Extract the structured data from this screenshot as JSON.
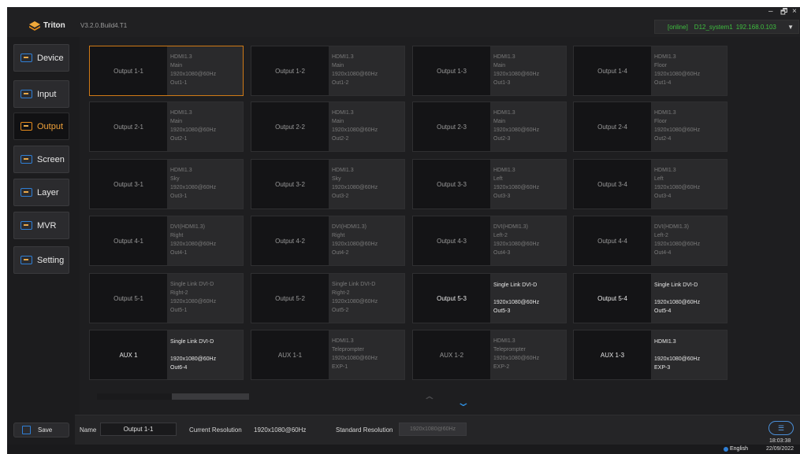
{
  "app": {
    "name": "Triton",
    "version": "V3.2.0.Build4.T1",
    "window_controls": {
      "minimize": "–",
      "maximize": "🗗",
      "close": "×"
    }
  },
  "device_status": {
    "online": "[online]",
    "device": "D12_system1",
    "ip": "192.168.0.103"
  },
  "sidebar": {
    "items": [
      {
        "label": "Device",
        "icon": "device-icon",
        "active": false
      },
      {
        "label": "Input",
        "icon": "input-icon",
        "active": false
      },
      {
        "label": "Output",
        "icon": "output-icon",
        "active": true
      },
      {
        "label": "Screen",
        "icon": "screen-icon",
        "active": false
      },
      {
        "label": "Layer",
        "icon": "layer-icon",
        "active": false
      },
      {
        "label": "MVR",
        "icon": "mvr-icon",
        "active": false
      },
      {
        "label": "Setting",
        "icon": "setting-icon",
        "active": false
      }
    ],
    "save_label": "Save"
  },
  "outputs": [
    {
      "name": "Output 1-1",
      "lines": [
        "HDMI1.3",
        "Main",
        "1920x1080@60Hz",
        "Out1-1"
      ],
      "bright": false,
      "selected": true
    },
    {
      "name": "Output 1-2",
      "lines": [
        "HDMI1.3",
        "Main",
        "1920x1080@60Hz",
        "Out1-2"
      ],
      "bright": false,
      "selected": false
    },
    {
      "name": "Output 1-3",
      "lines": [
        "HDMI1.3",
        "Main",
        "1920x1080@60Hz",
        "Out1-3"
      ],
      "bright": false,
      "selected": false
    },
    {
      "name": "Output 1-4",
      "lines": [
        "HDMI1.3",
        "Floor",
        "1920x1080@60Hz",
        "Out1-4"
      ],
      "bright": false,
      "selected": false
    },
    {
      "name": "Output 2-1",
      "lines": [
        "HDMI1.3",
        "Main",
        "1920x1080@60Hz",
        "Out2-1"
      ],
      "bright": false,
      "selected": false
    },
    {
      "name": "Output 2-2",
      "lines": [
        "HDMI1.3",
        "Main",
        "1920x1080@60Hz",
        "Out2-2"
      ],
      "bright": false,
      "selected": false
    },
    {
      "name": "Output 2-3",
      "lines": [
        "HDMI1.3",
        "Main",
        "1920x1080@60Hz",
        "Out2-3"
      ],
      "bright": false,
      "selected": false
    },
    {
      "name": "Output 2-4",
      "lines": [
        "HDMI1.3",
        "Floor",
        "1920x1080@60Hz",
        "Out2-4"
      ],
      "bright": false,
      "selected": false
    },
    {
      "name": "Output 3-1",
      "lines": [
        "HDMI1.3",
        "Sky",
        "1920x1080@60Hz",
        "Out3-1"
      ],
      "bright": false,
      "selected": false
    },
    {
      "name": "Output 3-2",
      "lines": [
        "HDMI1.3",
        "Sky",
        "1920x1080@60Hz",
        "Out3-2"
      ],
      "bright": false,
      "selected": false
    },
    {
      "name": "Output 3-3",
      "lines": [
        "HDMI1.3",
        "Left",
        "1920x1080@60Hz",
        "Out3-3"
      ],
      "bright": false,
      "selected": false
    },
    {
      "name": "Output 3-4",
      "lines": [
        "HDMI1.3",
        "Left",
        "1920x1080@60Hz",
        "Out3-4"
      ],
      "bright": false,
      "selected": false
    },
    {
      "name": "Output 4-1",
      "lines": [
        "DVI(HDMI1.3)",
        "Right",
        "1920x1080@60Hz",
        "Out4-1"
      ],
      "bright": false,
      "selected": false
    },
    {
      "name": "Output 4-2",
      "lines": [
        "DVI(HDMI1.3)",
        "Right",
        "1920x1080@60Hz",
        "Out4-2"
      ],
      "bright": false,
      "selected": false
    },
    {
      "name": "Output 4-3",
      "lines": [
        "DVI(HDMI1.3)",
        "Left-2",
        "1920x1080@60Hz",
        "Out4-3"
      ],
      "bright": false,
      "selected": false
    },
    {
      "name": "Output 4-4",
      "lines": [
        "DVI(HDMI1.3)",
        "Left-2",
        "1920x1080@60Hz",
        "Out4-4"
      ],
      "bright": false,
      "selected": false
    },
    {
      "name": "Output 5-1",
      "lines": [
        "Single Link DVI-D",
        "Right-2",
        "1920x1080@60Hz",
        "Out5-1"
      ],
      "bright": false,
      "selected": false
    },
    {
      "name": "Output 5-2",
      "lines": [
        "Single Link DVI-D",
        "Right-2",
        "1920x1080@60Hz",
        "Out5-2"
      ],
      "bright": false,
      "selected": false
    },
    {
      "name": "Output 5-3",
      "lines": [
        "Single Link DVI-D",
        "",
        "1920x1080@60Hz",
        "Out5-3"
      ],
      "bright": true,
      "selected": false
    },
    {
      "name": "Output 5-4",
      "lines": [
        "Single Link DVI-D",
        "",
        "1920x1080@60Hz",
        "Out5-4"
      ],
      "bright": true,
      "selected": false
    },
    {
      "name": "AUX 1",
      "lines": [
        "Single Link DVI-D",
        "",
        "1920x1080@60Hz",
        "Out6-4"
      ],
      "bright": true,
      "selected": false
    },
    {
      "name": "AUX 1-1",
      "lines": [
        "HDMI1.3",
        "Teleprompter",
        "1920x1080@60Hz",
        "EXP-1"
      ],
      "bright": false,
      "selected": false
    },
    {
      "name": "AUX 1-2",
      "lines": [
        "HDMI1.3",
        "Teleprompter",
        "1920x1080@60Hz",
        "EXP-2"
      ],
      "bright": false,
      "selected": false
    },
    {
      "name": "AUX 1-3",
      "lines": [
        "HDMI1.3",
        "",
        "1920x1080@60Hz",
        "EXP-3"
      ],
      "bright": true,
      "selected": false
    }
  ],
  "pager": {
    "up": "⌃",
    "down": "⌄"
  },
  "properties": {
    "name_label": "Name",
    "name_value": "Output 1-1",
    "current_resolution_label": "Current Resolution",
    "current_resolution_value": "1920x1080@60Hz",
    "standard_resolution_label": "Standard Resolution",
    "standard_resolution_value": "1920x1080@60Hz"
  },
  "statusbar": {
    "language": "English",
    "time": "18:03:38",
    "date": "22/09/2022"
  },
  "colors": {
    "accent": "#e48a1c",
    "brand_blue": "#2f7fd6",
    "online_green": "#3fbf3f",
    "background": "#1c1c1e"
  }
}
